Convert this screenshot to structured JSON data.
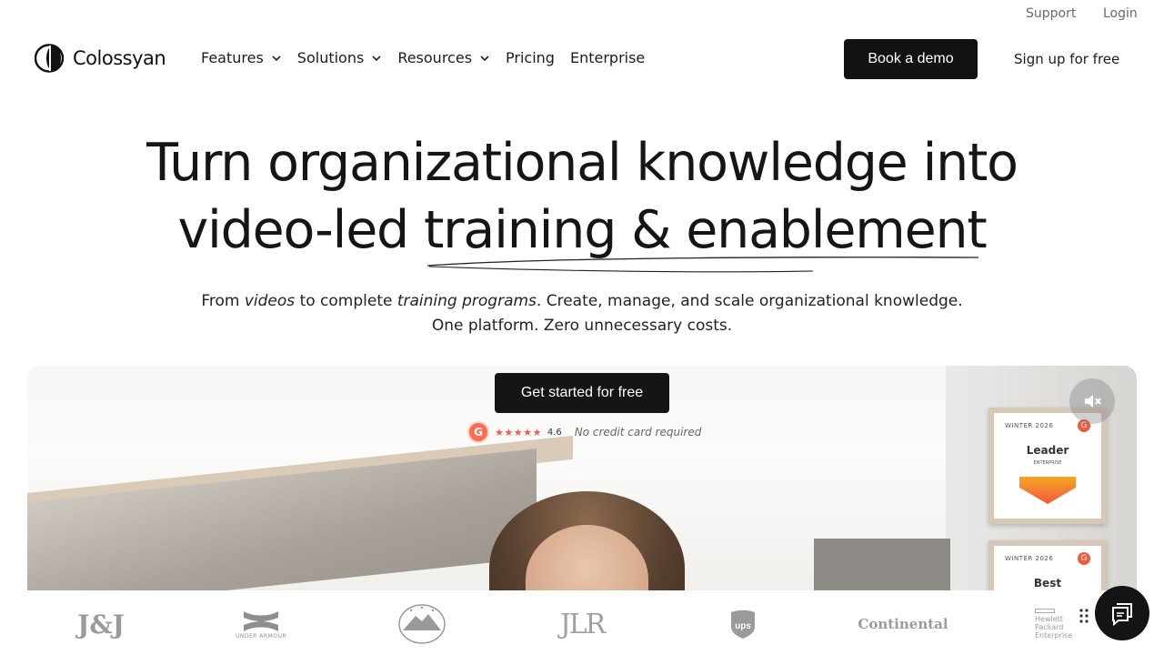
{
  "topbar": {
    "support": "Support",
    "login": "Login"
  },
  "brand": {
    "name": "Colossyan",
    "logo_icon": "colossyan-logo-icon"
  },
  "nav": {
    "items": [
      {
        "label": "Features",
        "has_dropdown": true
      },
      {
        "label": "Solutions",
        "has_dropdown": true
      },
      {
        "label": "Resources",
        "has_dropdown": true
      },
      {
        "label": "Pricing",
        "has_dropdown": false
      },
      {
        "label": "Enterprise",
        "has_dropdown": false
      }
    ],
    "book_demo": "Book a demo",
    "signup": "Sign up for free"
  },
  "hero": {
    "title_line1": "Turn organizational knowledge into",
    "title_line2_prefix": "video-led ",
    "title_line2_emphasis": "training & enablement",
    "sub_from": "From",
    "sub_videos": "videos",
    "sub_to": "to complete",
    "sub_programs": "training programs",
    "sub_rest": ". Create, manage, and scale organizational knowledge.",
    "sub_line2": "One platform. Zero unnecessary costs.",
    "cta": "Get started for free",
    "rating_badge": "G",
    "rating_stars": "★★★★★",
    "rating_score": "4.6",
    "rating_note": "No credit card required"
  },
  "video": {
    "award1": {
      "header": "WINTER 2026",
      "title": "Leader",
      "subtitle": "ENTERPRISE"
    },
    "award2": {
      "header": "WINTER 2026",
      "title": "Best"
    },
    "mute_icon": "speaker-muted-icon"
  },
  "logos": {
    "jj": "J&J",
    "ua": "UNDER ARMOUR",
    "jlr": "JLR",
    "continental": "Continental",
    "hpe_line1": "Hewlett Packard",
    "hpe_line2": "Enterprise"
  },
  "colors": {
    "primary": "#151515",
    "accent_g2": "#ff6d4f",
    "text_muted": "#6b6b6b"
  }
}
